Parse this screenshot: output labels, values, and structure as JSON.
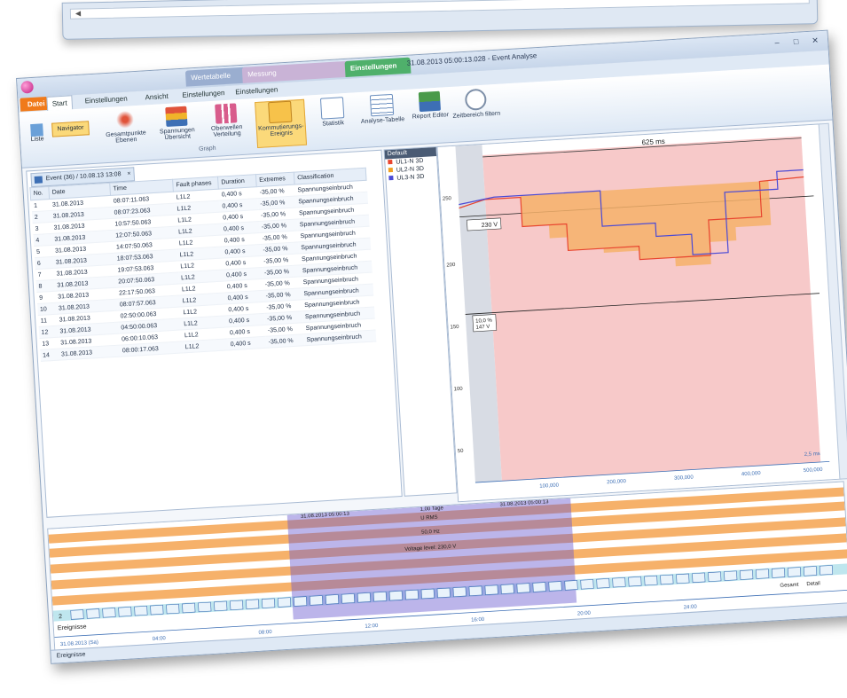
{
  "window": {
    "title": "31.08.2013 05:00:13.028 - Event Analyse",
    "contextual_tabs": [
      "Wertetabelle",
      "Messung",
      "Einstellungen"
    ]
  },
  "ribbon": {
    "tabs": [
      "Datei",
      "Start",
      "Einstellungen",
      "Ansicht",
      "Einstellungen",
      "Einstellungen"
    ],
    "buttons": [
      {
        "label": "Gesamtpunkte Ebenen",
        "icon": "fractal-icon"
      },
      {
        "label": "Spannungen Übersicht",
        "icon": "layers-icon"
      },
      {
        "label": "Oberwellen Verteilung",
        "icon": "bars-icon"
      },
      {
        "label": "Kommutierungs-Ereignis",
        "icon": "event-icon"
      },
      {
        "label": "Statistik",
        "icon": "report-icon"
      },
      {
        "label": "Analyse-Tabelle",
        "icon": "table-icon"
      },
      {
        "label": "Report Editor",
        "icon": "report-icon"
      },
      {
        "label": "Zeitbereich filtern",
        "icon": "clock-icon"
      }
    ],
    "small_buttons": [
      "Liste",
      "Navigator"
    ],
    "group_label": "Graph"
  },
  "events_table": {
    "tab_label": "Event (36) / 10.08.13 13:08",
    "columns": [
      "No.",
      "Date",
      "Time",
      "Fault phases",
      "Duration",
      "Extremes",
      "Classification"
    ],
    "rows": [
      [
        "1",
        "31.08.2013",
        "08:07:11.063",
        "L1L2",
        "0,400 s",
        "-35,00 %",
        "Spannungseinbruch"
      ],
      [
        "2",
        "31.08.2013",
        "08:07:23.063",
        "L1L2",
        "0,400 s",
        "-35,00 %",
        "Spannungseinbruch"
      ],
      [
        "3",
        "31.08.2013",
        "10:57:50.063",
        "L1L2",
        "0,400 s",
        "-35,00 %",
        "Spannungseinbruch"
      ],
      [
        "4",
        "31.08.2013",
        "12:07:50.063",
        "L1L2",
        "0,400 s",
        "-35,00 %",
        "Spannungseinbruch"
      ],
      [
        "5",
        "31.08.2013",
        "14:07:50.063",
        "L1L2",
        "0,400 s",
        "-35,00 %",
        "Spannungseinbruch"
      ],
      [
        "6",
        "31.08.2013",
        "18:07:53.063",
        "L1L2",
        "0,400 s",
        "-35,00 %",
        "Spannungseinbruch"
      ],
      [
        "7",
        "31.08.2013",
        "19:07:53.063",
        "L1L2",
        "0,400 s",
        "-35,00 %",
        "Spannungseinbruch"
      ],
      [
        "8",
        "31.08.2013",
        "20:07:50.063",
        "L1L2",
        "0,400 s",
        "-35,00 %",
        "Spannungseinbruch"
      ],
      [
        "9",
        "31.08.2013",
        "22:17:50.063",
        "L1L2",
        "0,400 s",
        "-35,00 %",
        "Spannungseinbruch"
      ],
      [
        "10",
        "31.08.2013",
        "08:07:57.063",
        "L1L2",
        "0,400 s",
        "-35,00 %",
        "Spannungseinbruch"
      ],
      [
        "11",
        "31.08.2013",
        "02:50:00.063",
        "L1L2",
        "0,400 s",
        "-35,00 %",
        "Spannungseinbruch"
      ],
      [
        "12",
        "31.08.2013",
        "04:50:00.063",
        "L1L2",
        "0,400 s",
        "-35,00 %",
        "Spannungseinbruch"
      ],
      [
        "13",
        "31.08.2013",
        "06:00:10.063",
        "L1L2",
        "0,400 s",
        "-35,00 %",
        "Spannungseinbruch"
      ],
      [
        "14",
        "31.08.2013",
        "08:00:17.063",
        "L1L2",
        "0,400 s",
        "-35,00 %",
        "Spannungseinbruch"
      ]
    ]
  },
  "legend": {
    "header": "Default",
    "items": [
      {
        "label": "UL1-N 3D",
        "color": "#e8452f"
      },
      {
        "label": "UL2-N 3D",
        "color": "#f0a020"
      },
      {
        "label": "UL3-N 3D",
        "color": "#4a4ad6"
      }
    ]
  },
  "waveform": {
    "top_label": "625 ms",
    "cursor_value": "230 V",
    "lower_marker": "10,0 %",
    "lower_marker_2": "147 V",
    "y_ticks": [
      "250",
      "200",
      "150",
      "100",
      "50"
    ],
    "x_ticks": [
      "100,000",
      "200,000",
      "300,000",
      "400,000",
      "500,000"
    ],
    "corner_label": "2,5 ms"
  },
  "timeline": {
    "selection_label": "31.08.2013 05:00:13",
    "span_label": "1,00 Tage",
    "end_label": "31.08.2013 05:00:13",
    "bands": [
      "U RMS",
      "50,0 Hz",
      "Voltage level: 230,0 V"
    ],
    "row_number": "2",
    "group_label": "Ereignisse",
    "right_labels": [
      "Gesamt",
      "Detail"
    ],
    "left_bottom": "31.08.2013 (Sa)",
    "axis_ticks": [
      "04:00",
      "08:00",
      "12:00",
      "16:00",
      "20:00",
      "24:00"
    ]
  },
  "status": {
    "text": "Ereignisse"
  }
}
